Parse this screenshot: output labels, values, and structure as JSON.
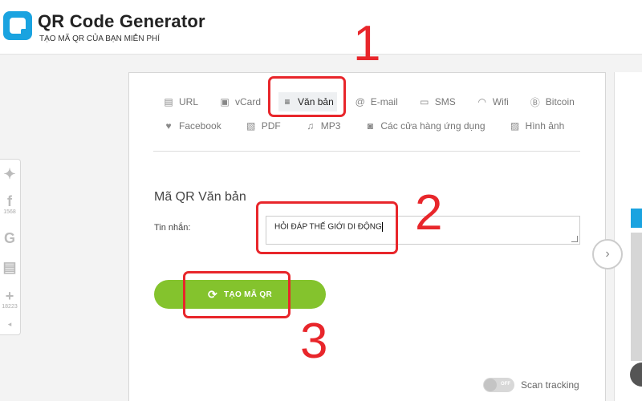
{
  "header": {
    "title": "QR Code Generator",
    "subtitle": "TẠO MÃ QR CỦA BẠN MIỄN PHÍ"
  },
  "social": [
    {
      "icon": "twitter-icon",
      "glyph": "🐦",
      "count": ""
    },
    {
      "icon": "facebook-icon",
      "glyph": "f",
      "count": "1568"
    },
    {
      "icon": "google-icon",
      "glyph": "G",
      "count": ""
    },
    {
      "icon": "print-icon",
      "glyph": "⎙",
      "count": ""
    },
    {
      "icon": "plus-icon",
      "glyph": "+",
      "count": "18223"
    }
  ],
  "tabs": {
    "row1": [
      {
        "label": "URL",
        "icon": "link-doc-icon",
        "glyph": "▤"
      },
      {
        "label": "vCard",
        "icon": "vcard-icon",
        "glyph": "▣"
      },
      {
        "label": "Văn bản",
        "icon": "text-lines-icon",
        "glyph": "≡",
        "active": true
      },
      {
        "label": "E-mail",
        "icon": "at-icon",
        "glyph": "@"
      },
      {
        "label": "SMS",
        "icon": "sms-icon",
        "glyph": "▭"
      },
      {
        "label": "Wifi",
        "icon": "wifi-icon",
        "glyph": "◠"
      },
      {
        "label": "Bitcoin",
        "icon": "bitcoin-icon",
        "glyph": "Ⓑ"
      }
    ],
    "row2": [
      {
        "label": "Facebook",
        "icon": "thumbs-up-icon",
        "glyph": "👍"
      },
      {
        "label": "PDF",
        "icon": "pdf-icon",
        "glyph": "▧"
      },
      {
        "label": "MP3",
        "icon": "music-icon",
        "glyph": "♫"
      },
      {
        "label": "Các cửa hàng ứng dụng",
        "icon": "app-store-icon",
        "glyph": "◙"
      },
      {
        "label": "Hình ảnh",
        "icon": "image-icon",
        "glyph": "▨"
      }
    ]
  },
  "form": {
    "section_title": "Mã QR Văn bản",
    "message_label": "Tin nhắn:",
    "message_value": "HỎI ĐÁP THẾ GIỚI DI ĐỘNG",
    "generate_label": "TẠO MÃ QR",
    "scan_tracking_label": "Scan tracking",
    "toggle_state": "OFF"
  },
  "annotations": {
    "one": "1",
    "two": "2",
    "three": "3"
  },
  "colors": {
    "brand": "#1aa3e0",
    "button": "#84c32d",
    "annotation": "#e8262b"
  }
}
